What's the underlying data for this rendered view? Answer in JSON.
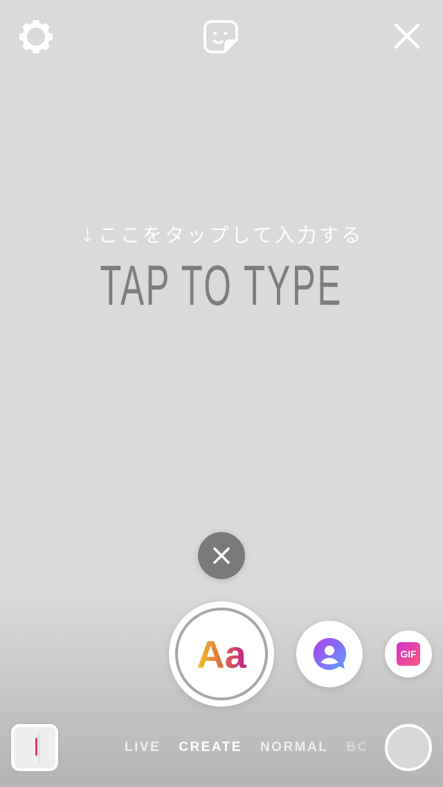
{
  "top": {
    "settings_icon": "gear-icon",
    "sticker_icon": "sticker-icon",
    "close_icon": "close-icon"
  },
  "canvas": {
    "hint": "↓ここをタップして入力する",
    "placeholder": "TAP TO TYPE"
  },
  "tools": {
    "dismiss_icon": "close-icon",
    "text_label": "Aa",
    "mention_icon": "avatar-bubble-icon",
    "gif_label": "GIF"
  },
  "modes": [
    "LIVE",
    "CREATE",
    "NORMAL",
    "BO"
  ],
  "selected_mode": "CREATE",
  "colors": {
    "background": "#dadada",
    "placeholder": "#7d7d7d",
    "accent_pink": "#e8336f",
    "accent_purple": "#a34cf0"
  }
}
